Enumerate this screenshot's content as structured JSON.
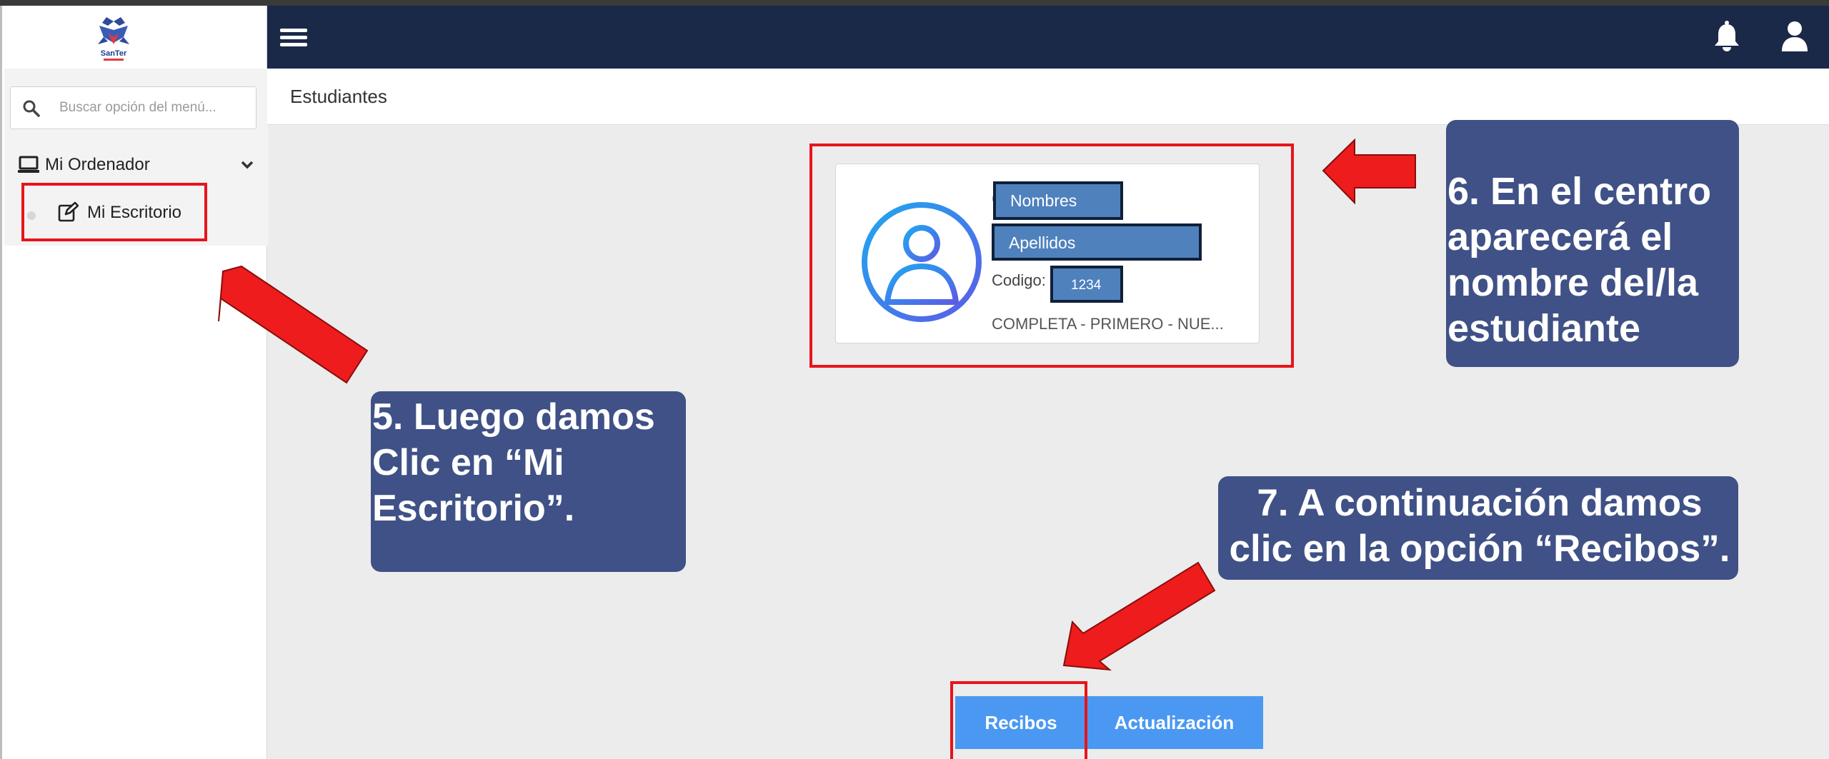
{
  "app": {
    "logo_text": "SanTer"
  },
  "sidebar": {
    "search_placeholder": "Buscar opción del menú...",
    "group_label": "Mi Ordenador",
    "item_label": "Mi Escritorio"
  },
  "breadcrumb": {
    "title": "Estudiantes"
  },
  "profile": {
    "names": "Nombres",
    "last_names": "Apellidos",
    "code_label": "Codigo:",
    "code_value": "1234",
    "grade": "COMPLETA - PRIMERO - NUE..."
  },
  "actions": {
    "recibos": "Recibos",
    "actualizacion": "Actualización"
  },
  "annotations": {
    "step5": "5. Luego damos Clic en “Mi Escritorio”.",
    "step6": " 6. En el centro aparecerá el nombre del/la estudiante",
    "step7": "7. A continuación damos clic en la opción “Recibos”."
  },
  "colors": {
    "topbar": "#1a2947",
    "button": "#4a98f2",
    "callout": "#3f5186",
    "highlight": "#e8141b"
  }
}
